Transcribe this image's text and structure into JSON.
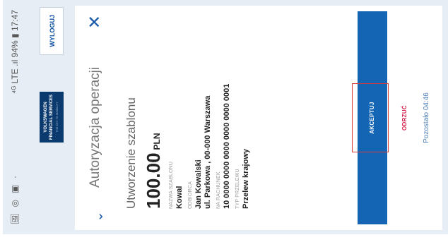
{
  "status_bar": {
    "left_icons": "🖼 ◎ ▣ ·",
    "right": "⁴ᴳ LTE .ıl 94% ▮ 17:47"
  },
  "header": {
    "logo_line1": "VOLKSWAGEN",
    "logo_line2": "FINANCIAL SERVICES",
    "logo_line3": "THE KEY TO MOBILITY",
    "logout_label": "WYLOGUJ"
  },
  "modal": {
    "title": "Autoryzacja operacji",
    "operation": "Utworzenie szablonu",
    "amount": "100.00",
    "currency": "PLN",
    "fields": [
      {
        "label": "NAZWA SZABLONU",
        "value": "Kowal"
      },
      {
        "label": "ODBIORCA",
        "value": "Jan Kowalski"
      },
      {
        "label": "",
        "value": "ul. Parkowa , 00-000 Warszawa"
      },
      {
        "label": "NA RACHUNEK",
        "value": "10 0000 0000 0000 0000 0000 0001"
      },
      {
        "label": "TYP PRZELEWU",
        "value": "Przelew krajowy"
      }
    ],
    "accept_label": "AKCEPTUJ",
    "reject_label": "ODRZUĆ",
    "remaining": "Pozostało 04:46"
  },
  "colors": {
    "accent": "#1565b5",
    "reject": "#d3224a",
    "highlight": "#d93a3a",
    "background": "#e7edf5"
  }
}
